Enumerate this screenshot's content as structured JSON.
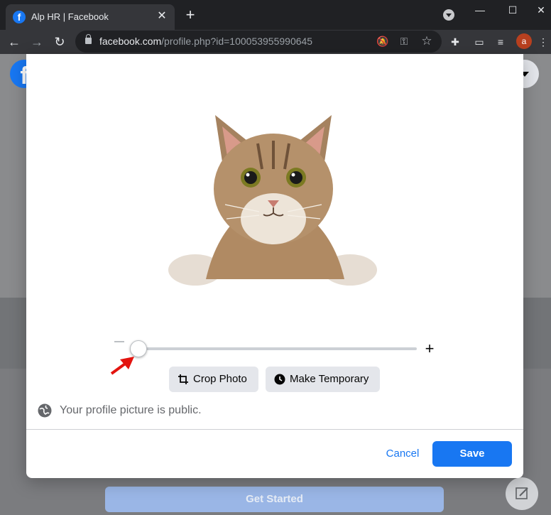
{
  "browser": {
    "tab_title": "Alp HR | Facebook",
    "tab_close": "✕",
    "new_tab": "+",
    "url_host": "facebook.com",
    "url_path": "/profile.php?id=100053955990645",
    "profile_initial": "a",
    "window_controls": {
      "minimize": "—",
      "maximize": "☐",
      "close": "✕"
    }
  },
  "facebook": {
    "logo_letter": "f",
    "header_buttons": [
      "create-icon",
      "messenger-icon",
      "notifications-icon",
      "account-menu-icon"
    ],
    "create_glyph": "+",
    "get_started": "Get Started"
  },
  "modal": {
    "zoom": {
      "min_symbol": "–",
      "max_symbol": "+",
      "level": 0.02
    },
    "crop_photo": "Crop Photo",
    "make_temporary": "Make Temporary",
    "privacy_note": "Your profile picture is public.",
    "cancel": "Cancel",
    "save": "Save"
  },
  "colors": {
    "brand_blue": "#1877f2",
    "annotation_arrow": "#e3140f"
  }
}
